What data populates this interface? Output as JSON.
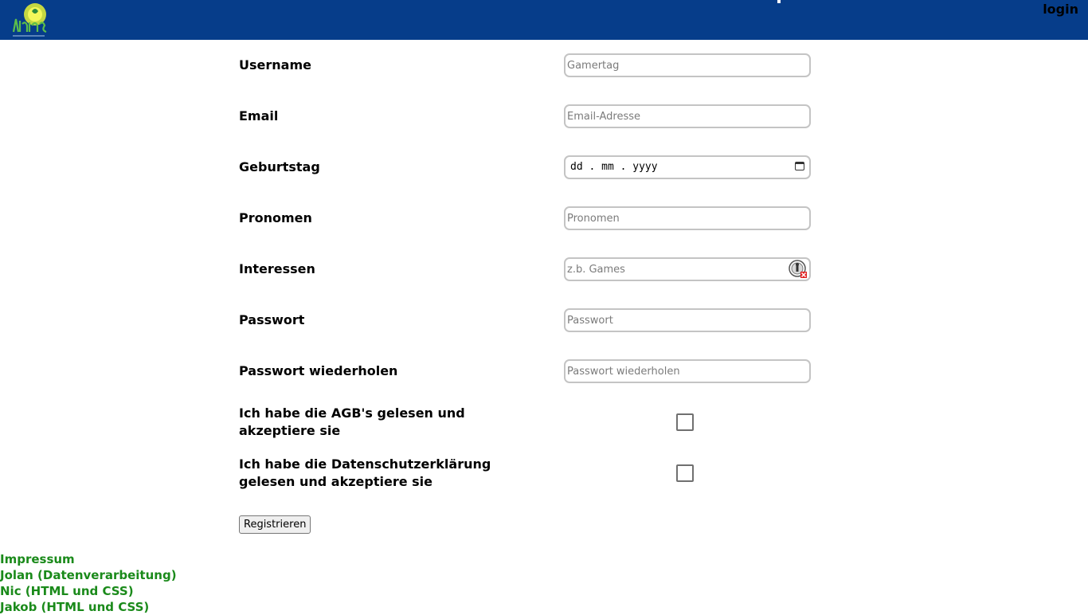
{
  "header": {
    "login_label": "login",
    "brand_color": "#063d8a"
  },
  "form": {
    "fields": [
      {
        "label": "Username",
        "placeholder": "Gamertag"
      },
      {
        "label": "Email",
        "placeholder": "Email-Adresse"
      },
      {
        "label": "Geburtstag",
        "value": "dd . mm . yyyy"
      },
      {
        "label": "Pronomen",
        "placeholder": "Pronomen"
      },
      {
        "label": "Interessen",
        "placeholder": "z.b. Games"
      },
      {
        "label": "Passwort",
        "placeholder": "Passwort"
      },
      {
        "label": "Passwort wiederholen",
        "placeholder": "Passwort wiederholen"
      }
    ],
    "checkboxes": [
      {
        "label": "Ich habe die AGB's gelesen und akzeptiere sie",
        "checked": false
      },
      {
        "label": "Ich habe die Datenschutzerklärung gelesen und akzeptiere sie",
        "checked": false
      }
    ],
    "submit_label": "Registrieren"
  },
  "footer": {
    "links": [
      "Impressum",
      "Jolan (Datenverarbeitung)",
      "Nic (HTML und CSS)",
      "Jakob (HTML und CSS)"
    ],
    "link_color": "#1a8a1a"
  },
  "icons": {
    "logo": "site-logo",
    "date_picker": "calendar-icon",
    "extension": "password-manager-icon"
  }
}
